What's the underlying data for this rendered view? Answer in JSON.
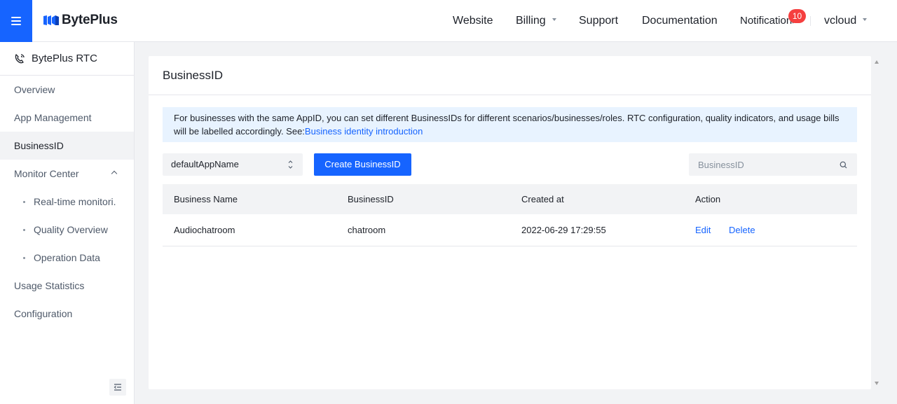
{
  "header": {
    "brand": "BytePlus",
    "nav": {
      "website": "Website",
      "billing": "Billing",
      "support": "Support",
      "documentation": "Documentation",
      "notifications": "Notifications",
      "notification_count": "10",
      "user": "vcloud"
    }
  },
  "sidebar": {
    "product": "BytePlus RTC",
    "items": [
      {
        "label": "Overview"
      },
      {
        "label": "App Management"
      },
      {
        "label": "BusinessID",
        "active": true
      },
      {
        "label": "Monitor Center",
        "expanded": true
      },
      {
        "label": "Real-time monitori."
      },
      {
        "label": "Quality Overview"
      },
      {
        "label": "Operation Data"
      },
      {
        "label": "Usage Statistics"
      },
      {
        "label": "Configuration"
      }
    ]
  },
  "main": {
    "title": "BusinessID",
    "info_text": "For businesses with the same AppID, you can set different BusinessIDs for different scenarios/businesses/roles. RTC configuration, quality indicators, and usage bills will be labelled accordingly. See:",
    "info_link": "Business identity introduction",
    "app_select_value": "defaultAppName",
    "create_button": "Create BusinessID",
    "search_placeholder": "BusinessID",
    "table": {
      "headers": [
        "Business Name",
        "BusinessID",
        "Created at",
        "Action"
      ],
      "rows": [
        {
          "name": "Audiochatroom",
          "id": "chatroom",
          "created": "2022-06-29 17:29:55",
          "edit": "Edit",
          "delete": "Delete"
        }
      ]
    }
  },
  "colors": {
    "accent": "#1664ff",
    "badge": "#f53f3f",
    "info_bg": "#e8f3ff"
  }
}
